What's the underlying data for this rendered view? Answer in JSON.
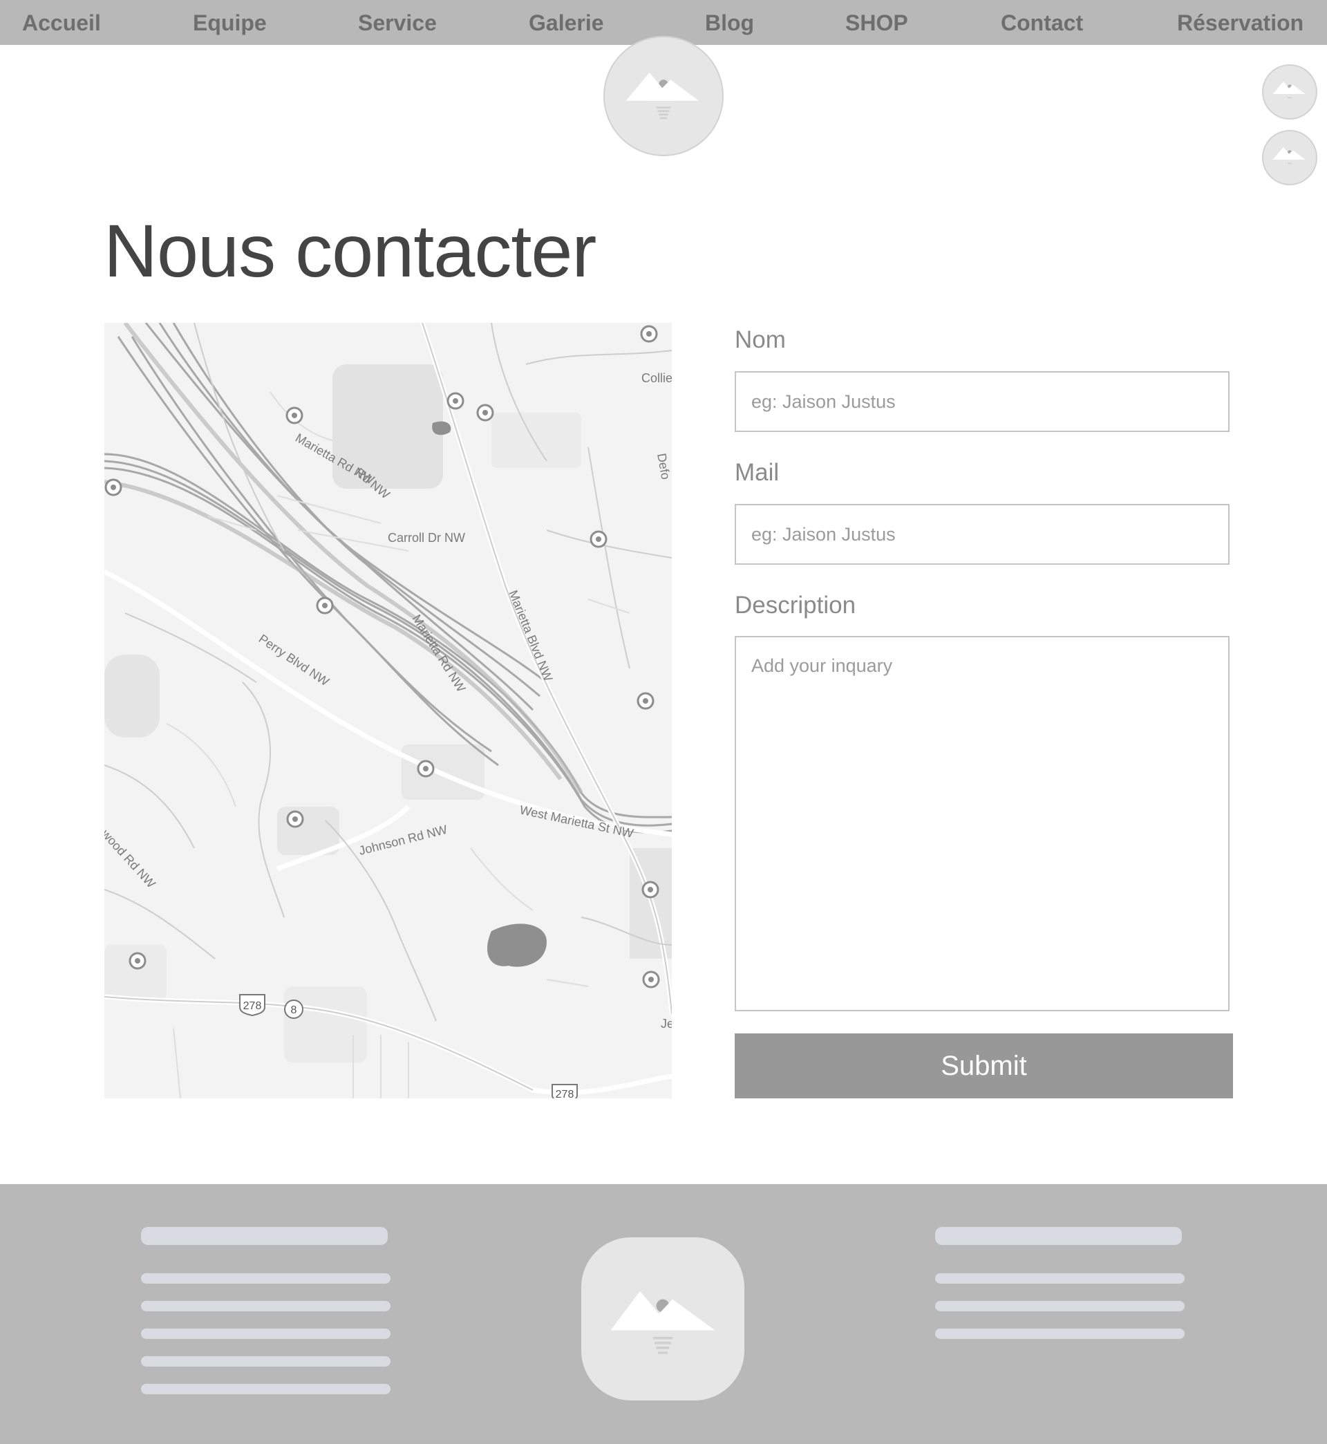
{
  "nav": {
    "items": [
      {
        "label": "Accueil"
      },
      {
        "label": "Equipe"
      },
      {
        "label": "Service"
      },
      {
        "label": "Galerie"
      },
      {
        "label": "Blog"
      },
      {
        "label": "SHOP"
      },
      {
        "label": "Contact"
      },
      {
        "label": "Réservation"
      }
    ]
  },
  "page": {
    "title": "Nous contacter"
  },
  "map": {
    "street_labels": [
      "Marietta Rd NW",
      "Carroll Dr NW",
      "Marietta Blvd NW",
      "Perry Blvd NW",
      "West Marietta St NW",
      "Johnson Rd NW",
      "Rd NW",
      "wood Rd NW",
      "Collie",
      "Defo",
      "Je"
    ],
    "route_shields": [
      "278",
      "8",
      "278"
    ]
  },
  "form": {
    "name_label": "Nom",
    "name_placeholder": "eg: Jaison Justus",
    "mail_label": "Mail",
    "mail_placeholder": "eg: Jaison Justus",
    "description_label": "Description",
    "description_placeholder": "Add your inquary",
    "submit_label": "Submit"
  },
  "colors": {
    "nav_bg": "#b8b8b8",
    "nav_text": "#6e6e6e",
    "footer_bg": "#b8b8b8",
    "button_bg": "#989898",
    "placeholder_image": "#e6e6e6",
    "placeholder_line": "#d9dbe2"
  },
  "icons": {
    "header_logo": "image-placeholder-icon",
    "side_icons": [
      "image-placeholder-icon",
      "image-placeholder-icon"
    ],
    "footer_logo": "image-placeholder-icon"
  }
}
